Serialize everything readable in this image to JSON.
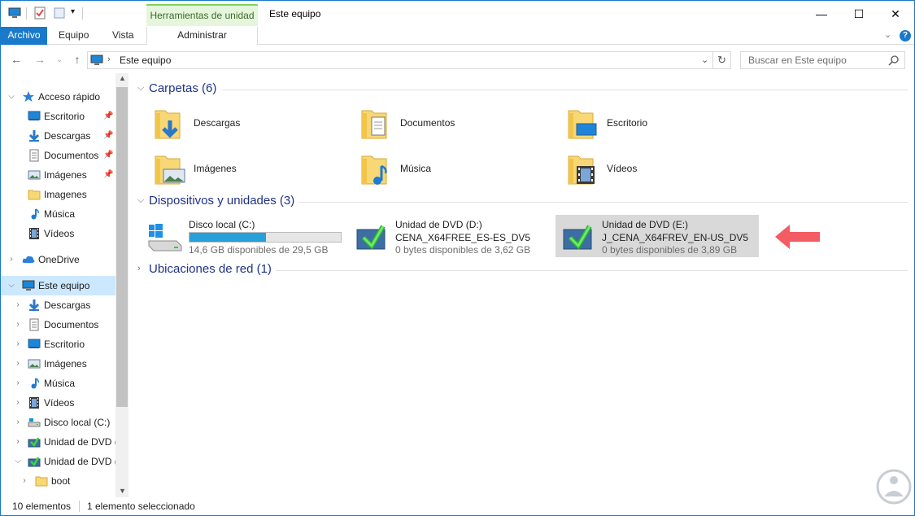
{
  "window": {
    "context_tab": "Herramientas de unidad",
    "title": "Este equipo",
    "controls": {
      "minimize": "—",
      "maximize": "☐",
      "close": "✕"
    }
  },
  "ribbon": {
    "file": "Archivo",
    "tabs": [
      "Equipo",
      "Vista"
    ],
    "context": "Administrar"
  },
  "address": {
    "path": "Este equipo",
    "search_placeholder": "Buscar en Este equipo"
  },
  "nav": {
    "quick_access": "Acceso rápido",
    "quick_items": [
      {
        "label": "Escritorio",
        "pinned": true,
        "icon": "desktop-icon"
      },
      {
        "label": "Descargas",
        "pinned": true,
        "icon": "download-icon"
      },
      {
        "label": "Documentos",
        "pinned": true,
        "icon": "document-icon"
      },
      {
        "label": "Imágenes",
        "pinned": true,
        "icon": "picture-icon"
      },
      {
        "label": "Imagenes",
        "pinned": false,
        "icon": "folder-icon"
      },
      {
        "label": "Música",
        "pinned": false,
        "icon": "music-icon"
      },
      {
        "label": "Vídeos",
        "pinned": false,
        "icon": "video-icon"
      }
    ],
    "onedrive": "OneDrive",
    "this_pc": "Este equipo",
    "pc_items": [
      {
        "label": "Descargas",
        "icon": "download-icon"
      },
      {
        "label": "Documentos",
        "icon": "document-icon"
      },
      {
        "label": "Escritorio",
        "icon": "desktop-icon"
      },
      {
        "label": "Imágenes",
        "icon": "picture-icon"
      },
      {
        "label": "Música",
        "icon": "music-icon"
      },
      {
        "label": "Vídeos",
        "icon": "video-icon"
      },
      {
        "label": "Disco local (C:)",
        "icon": "hard-drive-icon"
      },
      {
        "label": "Unidad de DVD (",
        "icon": "dvd-drive-icon"
      },
      {
        "label": "Unidad de DVD (",
        "icon": "dvd-drive-icon"
      }
    ],
    "sub_items": [
      {
        "label": "boot",
        "icon": "folder-icon"
      }
    ]
  },
  "content": {
    "folders_header": "Carpetas (6)",
    "folders": [
      {
        "label": "Descargas",
        "icon": "downloads-folder-icon"
      },
      {
        "label": "Documentos",
        "icon": "documents-folder-icon"
      },
      {
        "label": "Escritorio",
        "icon": "desktop-folder-icon"
      },
      {
        "label": "Imágenes",
        "icon": "pictures-folder-icon"
      },
      {
        "label": "Música",
        "icon": "music-folder-icon"
      },
      {
        "label": "Vídeos",
        "icon": "videos-folder-icon"
      }
    ],
    "devices_header": "Dispositivos y unidades (3)",
    "devices": [
      {
        "name": "Disco local (C:)",
        "volume": "",
        "free": "14,6 GB disponibles de 29,5 GB",
        "used_fraction": 0.505,
        "icon": "windows-drive-icon",
        "selected": false
      },
      {
        "name": "Unidad de DVD (D:)",
        "volume": "CENA_X64FREE_ES-ES_DV5",
        "free": "0 bytes disponibles de 3,62 GB",
        "icon": "dvd-install-icon",
        "selected": false
      },
      {
        "name": "Unidad de DVD (E:)",
        "volume": "J_CENA_X64FREV_EN-US_DV5",
        "free": "0 bytes disponibles de 3,89 GB",
        "icon": "dvd-install-icon",
        "selected": true
      }
    ],
    "network_header": "Ubicaciones de red (1)"
  },
  "status": {
    "count": "10 elementos",
    "selected": "1 elemento seleccionado"
  },
  "colors": {
    "accent": "#1979ca",
    "header": "#1e3287",
    "arrow": "#f25c62"
  }
}
